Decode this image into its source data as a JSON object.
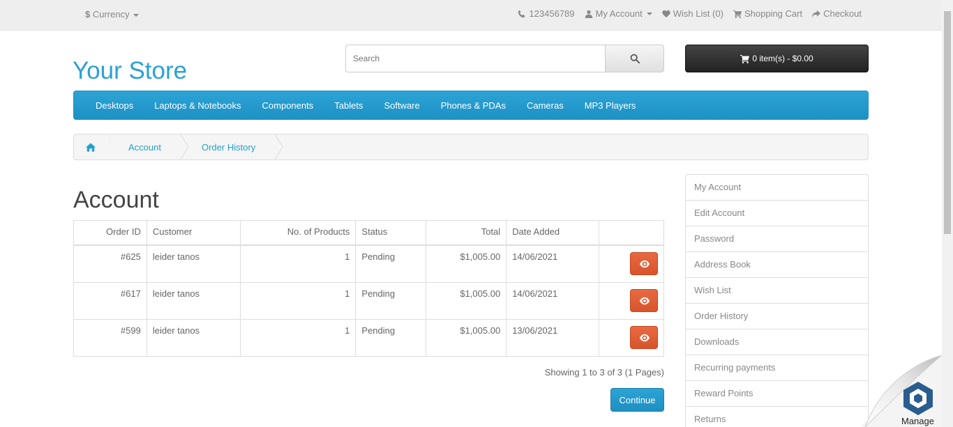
{
  "top_bar": {
    "currency_symbol": "$",
    "currency_label": "Currency",
    "phone": "123456789",
    "my_account": "My Account",
    "wish_list": "Wish List (0)",
    "shopping_cart": "Shopping Cart",
    "checkout": "Checkout"
  },
  "logo": "Your Store",
  "search": {
    "placeholder": "Search"
  },
  "cart": {
    "label": "0 item(s) - $0.00"
  },
  "menu": [
    "Desktops",
    "Laptops & Notebooks",
    "Components",
    "Tablets",
    "Software",
    "Phones & PDAs",
    "Cameras",
    "MP3 Players"
  ],
  "breadcrumb": [
    "Account",
    "Order History"
  ],
  "page_title": "Account",
  "table": {
    "headers": [
      "Order ID",
      "Customer",
      "No. of Products",
      "Status",
      "Total",
      "Date Added"
    ],
    "rows": [
      [
        "#625",
        "leider tanos",
        "1",
        "Pending",
        "$1,005.00",
        "14/06/2021"
      ],
      [
        "#617",
        "leider tanos",
        "1",
        "Pending",
        "$1,005.00",
        "14/06/2021"
      ],
      [
        "#599",
        "leider tanos",
        "1",
        "Pending",
        "$1,005.00",
        "13/06/2021"
      ]
    ]
  },
  "pagination_info": "Showing 1 to 3 of 3 (1 Pages)",
  "continue_label": "Continue",
  "account_nav": [
    "My Account",
    "Edit Account",
    "Password",
    "Address Book",
    "Wish List",
    "Order History",
    "Downloads",
    "Recurring payments",
    "Reward Points",
    "Returns"
  ],
  "widget": {
    "label": "Manage"
  },
  "colors": {
    "accent": "#23a1d1",
    "menu_bg": "#229ac8",
    "danger": "#e0602f",
    "cart_bg": "#363636"
  }
}
